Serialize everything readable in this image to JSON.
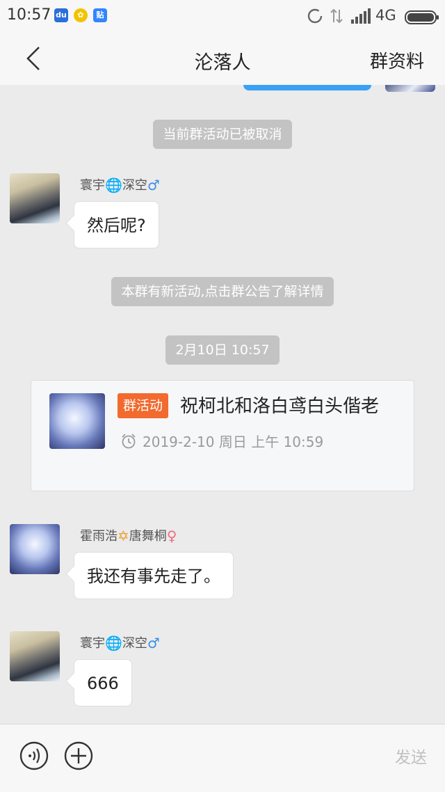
{
  "status_bar": {
    "time": "10:57",
    "network": "4G"
  },
  "nav": {
    "title": "沦落人",
    "right_label": "群资料"
  },
  "chat": {
    "system1": "当前群活动已被取消",
    "msg1": {
      "sender_a": "寰宇",
      "sender_b": "深空",
      "gender": "♂",
      "text": "然后呢?"
    },
    "system2": "本群有新活动,点击群公告了解详情",
    "timestamp": "2月10日 10:57",
    "activity": {
      "tag": "群活动",
      "title": "祝柯北和洛白鸢白头偕老",
      "time": "2019-2-10 周日 上午 10:59"
    },
    "msg2": {
      "sender_a": "霍雨浩",
      "sender_b": "唐舞桐",
      "gender": "♀",
      "text": "我还有事先走了。"
    },
    "msg3": {
      "sender_a": "寰宇",
      "sender_b": "深空",
      "gender": "♂",
      "text": "666"
    }
  },
  "input_bar": {
    "send_label": "发送"
  },
  "icons": {
    "statusbar": [
      "du-app-icon",
      "clover-app-icon",
      "tieba-app-icon",
      "sync-icon",
      "data-arrows-icon",
      "signal-icon",
      "battery-icon"
    ],
    "nav": [
      "back-chevron-icon"
    ],
    "input": [
      "voice-icon",
      "plus-icon"
    ]
  },
  "colors": {
    "activity_tag": "#f26a2e",
    "male": "#3a8ee6",
    "female": "#f06c7e",
    "system_notice_bg": "#c3c3c3"
  }
}
